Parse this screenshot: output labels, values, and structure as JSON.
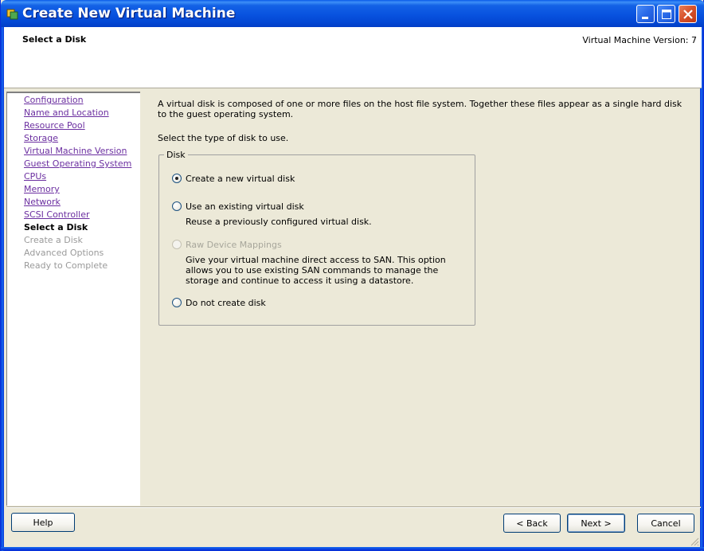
{
  "window": {
    "title": "Create New Virtual Machine"
  },
  "header": {
    "title": "Select a Disk",
    "version": "Virtual Machine Version: 7"
  },
  "sidebar": {
    "items": [
      {
        "label": "Configuration",
        "state": "link"
      },
      {
        "label": "Name and Location",
        "state": "link"
      },
      {
        "label": "Resource Pool",
        "state": "link"
      },
      {
        "label": "Storage",
        "state": "link"
      },
      {
        "label": "Virtual Machine Version",
        "state": "link"
      },
      {
        "label": "Guest Operating System",
        "state": "link"
      },
      {
        "label": "CPUs",
        "state": "link"
      },
      {
        "label": "Memory",
        "state": "link"
      },
      {
        "label": "Network",
        "state": "link"
      },
      {
        "label": "SCSI Controller",
        "state": "link"
      },
      {
        "label": "Select a Disk",
        "state": "current"
      },
      {
        "label": "Create a Disk",
        "state": "disabled"
      },
      {
        "label": "Advanced Options",
        "state": "disabled"
      },
      {
        "label": "Ready to Complete",
        "state": "disabled"
      }
    ]
  },
  "content": {
    "description": "A virtual disk is composed of one or more files on the host file system. Together these files appear as a single hard disk to the guest operating system.",
    "prompt": "Select the type of disk to use.",
    "group_label": "Disk",
    "options": [
      {
        "label": "Create a new virtual disk",
        "sub": "",
        "selected": true,
        "enabled": true
      },
      {
        "label": "Use an existing virtual disk",
        "sub": "Reuse a previously configured virtual disk.",
        "selected": false,
        "enabled": true
      },
      {
        "label": "Raw Device Mappings",
        "sub": "Give your virtual machine direct access to SAN. This option allows you to use existing SAN commands to manage the storage and continue to access it using a datastore.",
        "selected": false,
        "enabled": false
      },
      {
        "label": "Do not create disk",
        "sub": "",
        "selected": false,
        "enabled": true
      }
    ]
  },
  "footer": {
    "help": "Help",
    "back": "< Back",
    "next": "Next >",
    "cancel": "Cancel"
  },
  "colors": {
    "titlebar": "#0852df",
    "link": "#6b2fa0",
    "disabled": "#9a9a9a",
    "dialog_bg": "#ece9d8"
  },
  "icons": {
    "title": "vm-icon",
    "minimize": "minimize-icon",
    "maximize": "maximize-icon",
    "close": "close-icon",
    "resize": "resize-grip-icon"
  }
}
